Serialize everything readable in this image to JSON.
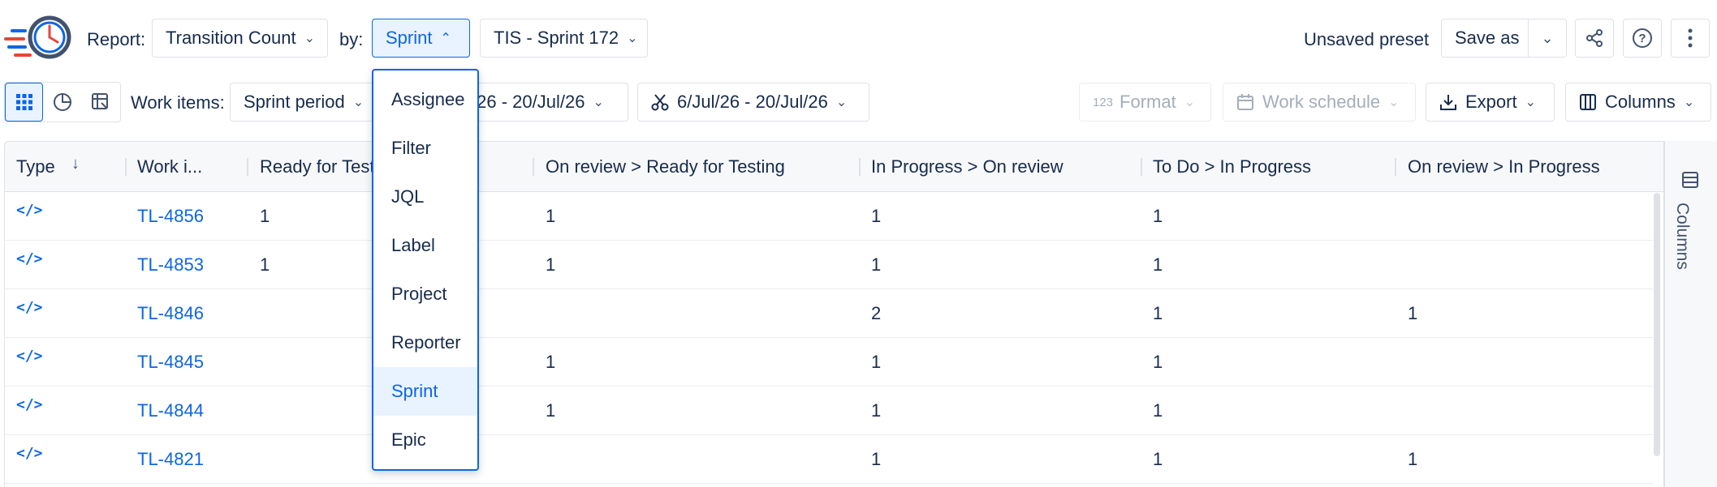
{
  "toolbar": {
    "report_label": "Report:",
    "report_value": "Transition Count",
    "by_label": "by:",
    "by_value": "Sprint",
    "sprint_value": "TIS - Sprint 172",
    "unsaved_label": "Unsaved preset",
    "save_as_label": "Save as"
  },
  "toolbar2": {
    "work_items_label": "Work items:",
    "work_items_value": "Sprint period",
    "date_range_1": "/26 - 20/Jul/26",
    "date_range_2": "6/Jul/26 - 20/Jul/26",
    "format_label": "Format",
    "format_icon_text": "123",
    "work_schedule_label": "Work schedule",
    "export_label": "Export",
    "columns_label": "Columns"
  },
  "dropdown": {
    "items": [
      "Assignee",
      "Filter",
      "JQL",
      "Label",
      "Project",
      "Reporter",
      "Sprint",
      "Epic"
    ],
    "selected": "Sprint"
  },
  "table": {
    "headers": [
      "Type",
      "Work i...",
      "Ready for Testi",
      "On review > Ready for Testing",
      "In Progress > On review",
      "To Do > In Progress",
      "On review > In Progress"
    ],
    "rows": [
      {
        "type_icon": "</>",
        "key": "TL-4856",
        "c1": "1",
        "c2": "1",
        "c3": "1",
        "c4": "1",
        "c5": ""
      },
      {
        "type_icon": "</>",
        "key": "TL-4853",
        "c1": "1",
        "c2": "1",
        "c3": "1",
        "c4": "1",
        "c5": ""
      },
      {
        "type_icon": "</>",
        "key": "TL-4846",
        "c1": "",
        "c2": "",
        "c3": "2",
        "c4": "1",
        "c5": "1"
      },
      {
        "type_icon": "</>",
        "key": "TL-4845",
        "c1": "",
        "c2": "1",
        "c3": "1",
        "c4": "1",
        "c5": ""
      },
      {
        "type_icon": "</>",
        "key": "TL-4844",
        "c1": "",
        "c2": "1",
        "c3": "1",
        "c4": "1",
        "c5": ""
      },
      {
        "type_icon": "</>",
        "key": "TL-4821",
        "c1": "",
        "c2": "",
        "c3": "1",
        "c4": "1",
        "c5": "1"
      }
    ]
  },
  "side_panel": {
    "label": "Columns"
  },
  "colors": {
    "accent": "#0c66e4",
    "selected_bg": "#e9f2ff",
    "border": "#dfe1e6",
    "logo_red": "#e2483d"
  }
}
